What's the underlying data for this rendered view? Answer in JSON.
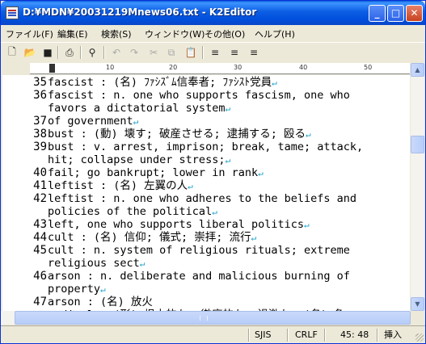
{
  "window": {
    "title": "D:¥MDN¥20031219Mnews06.txt - K2Editor",
    "min_glyph": "_",
    "max_glyph": "□",
    "close_glyph": "✕"
  },
  "menu": [
    "ファイル(F)",
    "編集(E)",
    "検索(S)",
    "ウィンドウ(W)",
    "その他(O)",
    "ヘルプ(H)"
  ],
  "toolbar": {
    "icons": [
      "new-file-icon",
      "open-folder-icon",
      "save-icon",
      "print-icon",
      "search-icon",
      "undo-icon",
      "redo-icon",
      "cut-icon",
      "copy-icon",
      "paste-icon",
      "align-left-icon",
      "align-center-icon",
      "align-right-icon"
    ],
    "glyphs": {
      "new": "🗋",
      "open": "📂",
      "save": "■",
      "print": "⎙",
      "search": "⚲",
      "undo": "↶",
      "redo": "↷",
      "cut": "✂",
      "copy": "⧉",
      "paste": "📋",
      "left": "≡",
      "center": "≡",
      "right": "≡"
    }
  },
  "ruler": {
    "labels": [
      "10",
      "20",
      "30",
      "40",
      "50"
    ]
  },
  "editor": {
    "return_mark": "↵",
    "lines": [
      {
        "num": "35",
        "text": "fascist : (名) ﾌｧｼｽﾞﾑ信奉者; ﾌｧｼｽﾄ党員"
      },
      {
        "num": "36",
        "text": "fascist : n. one who supports fascism, one who"
      },
      {
        "num": "",
        "text": "favors a dictatorial system"
      },
      {
        "num": "37",
        "text": "of government"
      },
      {
        "num": "38",
        "text": "bust : (動) 壊す; 破産させる; 逮捕する; 殴る"
      },
      {
        "num": "39",
        "text": "bust : v. arrest, imprison; break, tame; attack,"
      },
      {
        "num": "",
        "text": "hit; collapse under stress;"
      },
      {
        "num": "40",
        "text": "fail; go bankrupt; lower in rank"
      },
      {
        "num": "41",
        "text": "leftist : (名) 左翼の人"
      },
      {
        "num": "42",
        "text": "leftist : n. one who adheres to the beliefs and"
      },
      {
        "num": "",
        "text": "policies of the political"
      },
      {
        "num": "43",
        "text": "left, one who supports liberal politics"
      },
      {
        "num": "44",
        "text": "cult : (名) 信仰; 儀式; 崇拝; 流行"
      },
      {
        "num": "45",
        "text": "cult : n. system of religious rituals; extreme"
      },
      {
        "num": "",
        "text": "religious sect"
      },
      {
        "num": "46",
        "text": "arson : n. deliberate and malicious burning of"
      },
      {
        "num": "",
        "text": "property"
      },
      {
        "num": "47",
        "text": "arson : (名) 放火"
      },
      {
        "num": "",
        "text": "radical : (形) 根本的な; 徹底的な; 過激な; (名) 急"
      }
    ]
  },
  "status": {
    "encoding": "SJIS",
    "line_ending": "CRLF",
    "position": "45: 48",
    "mode": "挿入"
  }
}
